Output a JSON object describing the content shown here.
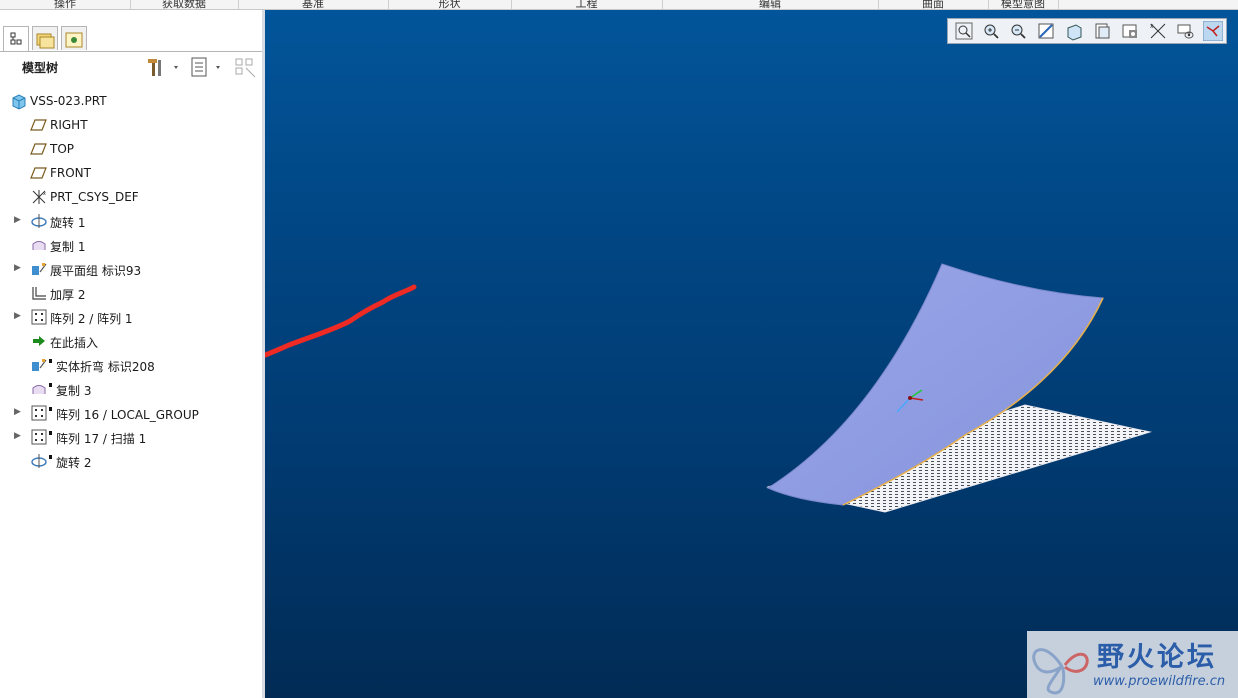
{
  "ribbon": {
    "tabs": [
      "操作",
      "获取数据",
      "基准",
      "形状",
      "工程",
      "编辑",
      "曲面",
      "模型意图"
    ]
  },
  "panel": {
    "title": "模型树"
  },
  "tree": [
    {
      "label": "VSS-023.PRT",
      "icon": "part-icon",
      "expandable": false,
      "marked": false
    },
    {
      "label": "RIGHT",
      "icon": "datum-plane-icon",
      "expandable": false,
      "marked": false
    },
    {
      "label": "TOP",
      "icon": "datum-plane-icon",
      "expandable": false,
      "marked": false
    },
    {
      "label": "FRONT",
      "icon": "datum-plane-icon",
      "expandable": false,
      "marked": false
    },
    {
      "label": "PRT_CSYS_DEF",
      "icon": "csys-icon",
      "expandable": false,
      "marked": false
    },
    {
      "label": "旋转 1",
      "icon": "revolve-icon",
      "expandable": true,
      "marked": false
    },
    {
      "label": "复制 1",
      "icon": "copy-surface-icon",
      "expandable": false,
      "marked": false
    },
    {
      "label": "展平面组 标识93",
      "icon": "flatten-quilt-icon",
      "expandable": true,
      "marked": false
    },
    {
      "label": "加厚 2",
      "icon": "thicken-icon",
      "expandable": false,
      "marked": false
    },
    {
      "label": "阵列 2 / 阵列 1",
      "icon": "pattern-icon",
      "expandable": true,
      "marked": false
    },
    {
      "label": "在此插入",
      "icon": "insert-here-arrow-icon",
      "expandable": false,
      "marked": false
    },
    {
      "label": "实体折弯 标识208",
      "icon": "solid-bend-icon",
      "expandable": false,
      "marked": true
    },
    {
      "label": "复制 3",
      "icon": "copy-surface-icon",
      "expandable": false,
      "marked": true
    },
    {
      "label": "阵列 16 / LOCAL_GROUP",
      "icon": "pattern-icon",
      "expandable": true,
      "marked": true
    },
    {
      "label": "阵列 17 / 扫描 1",
      "icon": "pattern-icon",
      "expandable": true,
      "marked": true
    },
    {
      "label": "旋转 2",
      "icon": "revolve-icon",
      "expandable": false,
      "marked": true
    }
  ],
  "view_toolbar": [
    "refit-icon",
    "zoom-in-icon",
    "zoom-out-icon",
    "repaint-icon",
    "display-style-icon",
    "saved-views-icon",
    "view-manager-icon",
    "datum-display-icon",
    "spin-center-icon",
    "annotation-display-icon"
  ],
  "watermark": {
    "title": "野火论坛",
    "url": "www.proewildfire.cn"
  },
  "colors": {
    "viewport_top": "#02559a",
    "viewport_bottom": "#012b55",
    "surface": "#8f9fe2",
    "annotation_stroke": "#ee2a24",
    "logo_text": "#2b5da8"
  }
}
